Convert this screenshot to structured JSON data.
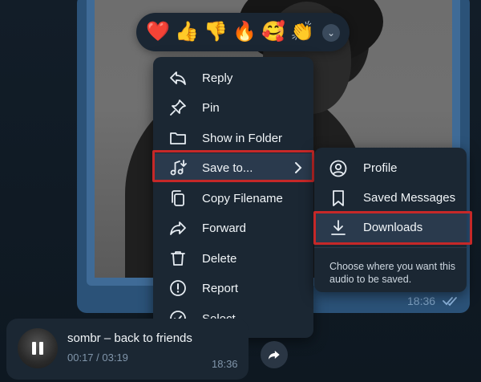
{
  "reactions": {
    "items": [
      {
        "emoji": "❤️",
        "name": "heart"
      },
      {
        "emoji": "👍",
        "name": "thumbs-up"
      },
      {
        "emoji": "👎",
        "name": "thumbs-down"
      },
      {
        "emoji": "🔥",
        "name": "fire"
      },
      {
        "emoji": "🥰",
        "name": "smiling-face-with-hearts"
      },
      {
        "emoji": "👏",
        "name": "clapping-hands"
      }
    ],
    "expand_icon": "chevron-down-icon"
  },
  "context_menu": {
    "items": [
      {
        "label": "Reply",
        "icon": "reply-icon"
      },
      {
        "label": "Pin",
        "icon": "pin-icon"
      },
      {
        "label": "Show in Folder",
        "icon": "folder-icon"
      },
      {
        "label": "Save to...",
        "icon": "music-save-icon",
        "submenu": true,
        "highlighted": true
      },
      {
        "label": "Copy Filename",
        "icon": "copy-icon"
      },
      {
        "label": "Forward",
        "icon": "forward-icon"
      },
      {
        "label": "Delete",
        "icon": "trash-icon"
      },
      {
        "label": "Report",
        "icon": "report-icon"
      },
      {
        "label": "Select",
        "icon": "check-circle-icon"
      }
    ]
  },
  "submenu": {
    "items": [
      {
        "label": "Profile",
        "icon": "profile-icon"
      },
      {
        "label": "Saved Messages",
        "icon": "bookmark-icon"
      },
      {
        "label": "Downloads",
        "icon": "download-icon",
        "highlighted": true
      }
    ],
    "hint": "Choose where you want this audio to be saved."
  },
  "message": {
    "time": "18:36",
    "status": "read"
  },
  "audio": {
    "title": "sombr – back to friends",
    "progress": "00:17 / 03:19",
    "time": "18:36"
  },
  "colors": {
    "highlight_border": "#c62828",
    "menu_bg": "#1b2733",
    "bubble_out": "#2b5278"
  }
}
